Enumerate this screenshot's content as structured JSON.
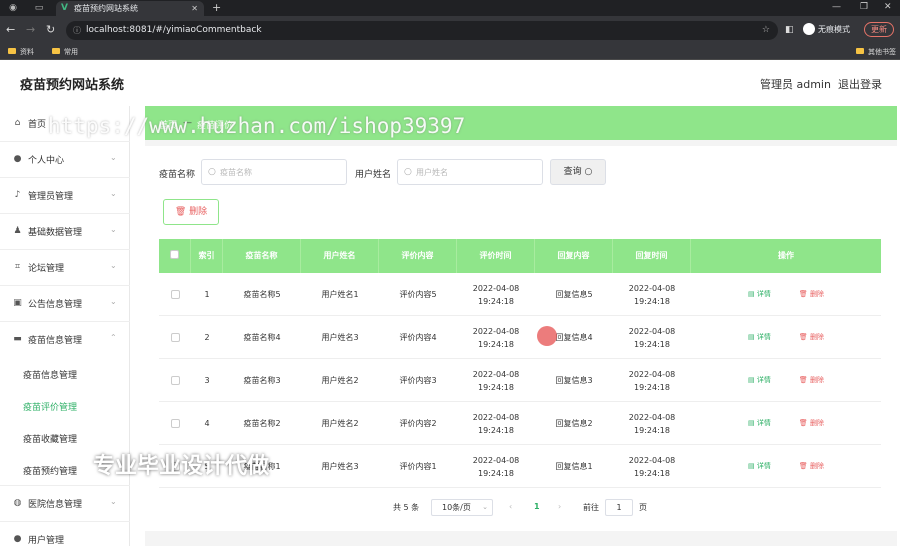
{
  "browser": {
    "tab_title": "疫苗预约网站系统",
    "url": "localhost:8081/#/yimiaoCommentback",
    "guest_label": "无痕模式",
    "update_label": "更新",
    "bookmarks": [
      "资料",
      "常用"
    ],
    "other_bookmarks": "其他书签"
  },
  "header": {
    "title": "疫苗预约网站系统",
    "user": "管理员 admin",
    "logout": "退出登录"
  },
  "sidebar": {
    "items": [
      {
        "label": "首页",
        "icon": "home-icon"
      },
      {
        "label": "个人中心",
        "icon": "user-icon"
      },
      {
        "label": "管理员管理",
        "icon": "mic-icon"
      },
      {
        "label": "基础数据管理",
        "icon": "person-icon"
      },
      {
        "label": "论坛管理",
        "icon": "crop-icon"
      },
      {
        "label": "公告信息管理",
        "icon": "chart-icon"
      },
      {
        "label": "疫苗信息管理",
        "icon": "monitor-icon"
      }
    ],
    "sub_items": [
      {
        "label": "疫苗信息管理"
      },
      {
        "label": "疫苗评价管理"
      },
      {
        "label": "疫苗收藏管理"
      },
      {
        "label": "疫苗预约管理"
      }
    ],
    "bottom_items": [
      {
        "label": "医院信息管理",
        "icon": "globe-icon"
      },
      {
        "label": "用户管理",
        "icon": "user-icon"
      }
    ]
  },
  "breadcrumb": {
    "home": "首页",
    "current": "疫苗评价"
  },
  "search": {
    "vaccine_label": "疫苗名称",
    "vaccine_placeholder": "疫苗名称",
    "user_label": "用户姓名",
    "user_placeholder": "用户姓名",
    "query_label": "查询"
  },
  "actions": {
    "delete_label": "删除"
  },
  "table": {
    "headers": [
      "索引",
      "疫苗名称",
      "用户姓名",
      "评价内容",
      "评价时间",
      "回复内容",
      "回复时间",
      "操作"
    ],
    "rows": [
      {
        "index": "1",
        "vaccine": "疫苗名称5",
        "user": "用户姓名1",
        "content": "评价内容5",
        "time": "2022-04-08 19:24:18",
        "reply": "回复信息5",
        "reply_time": "2022-04-08 19:24:18"
      },
      {
        "index": "2",
        "vaccine": "疫苗名称4",
        "user": "用户姓名3",
        "content": "评价内容4",
        "time": "2022-04-08 19:24:18",
        "reply": "回复信息4",
        "reply_time": "2022-04-08 19:24:18"
      },
      {
        "index": "3",
        "vaccine": "疫苗名称3",
        "user": "用户姓名2",
        "content": "评价内容3",
        "time": "2022-04-08 19:24:18",
        "reply": "回复信息3",
        "reply_time": "2022-04-08 19:24:18"
      },
      {
        "index": "4",
        "vaccine": "疫苗名称2",
        "user": "用户姓名2",
        "content": "评价内容2",
        "time": "2022-04-08 19:24:18",
        "reply": "回复信息2",
        "reply_time": "2022-04-08 19:24:18"
      },
      {
        "index": "5",
        "vaccine": "疫苗名称1",
        "user": "用户姓名3",
        "content": "评价内容1",
        "time": "2022-04-08 19:24:18",
        "reply": "回复信息1",
        "reply_time": "2022-04-08 19:24:18"
      }
    ],
    "detail_label": "详情",
    "delete_label": "删除"
  },
  "pagination": {
    "total": "共 5 条",
    "page_size": "10条/页",
    "current_page": "1",
    "goto_label": "前往",
    "goto_value": "1",
    "page_unit": "页"
  },
  "overlay": {
    "watermark": "https://www.huzhan.com/ishop39397",
    "promo": "专业毕业设计代做"
  },
  "colors": {
    "accent_green": "#8fe58a",
    "active_text": "#2fb067",
    "danger": "#e86060"
  }
}
